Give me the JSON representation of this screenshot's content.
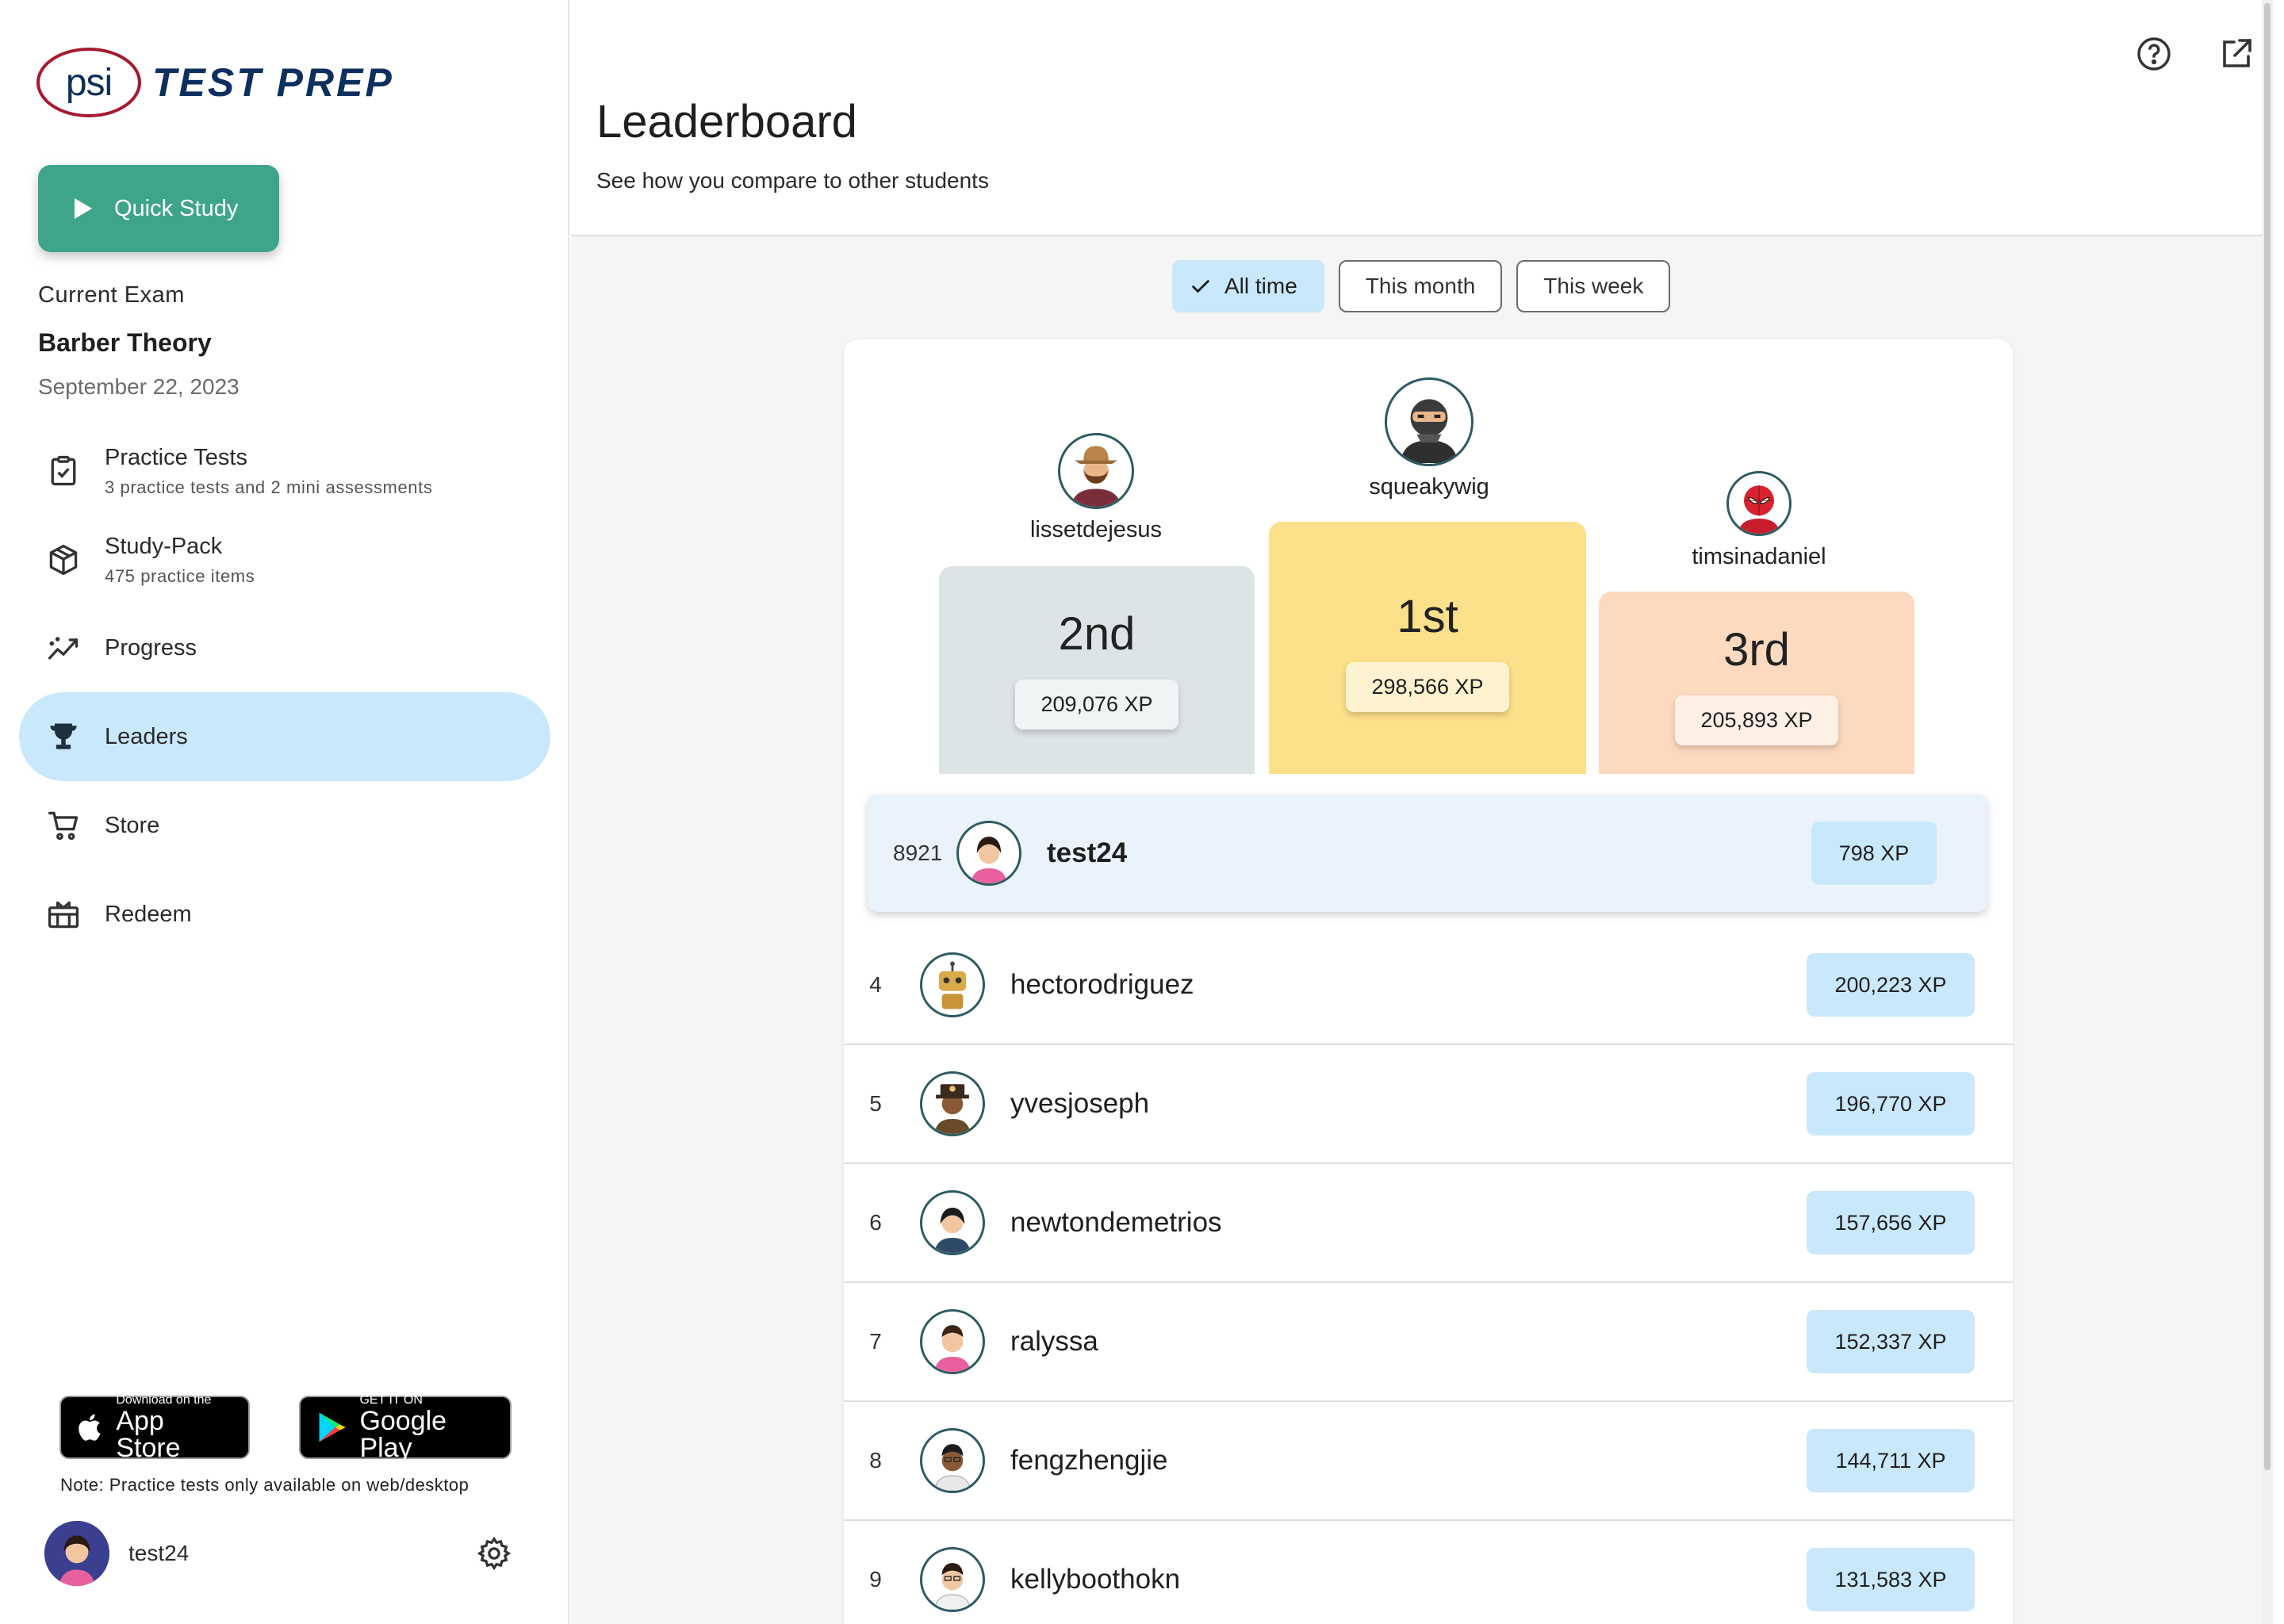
{
  "brand": {
    "mark": "psi",
    "name": "TEST PREP",
    "color": "#a6192e",
    "navy": "#0d2f5f"
  },
  "sidebar": {
    "quick_study_label": "Quick Study",
    "current_exam_label": "Current Exam",
    "exam_name": "Barber Theory",
    "exam_date": "September 22, 2023",
    "nav": [
      {
        "label": "Practice Tests",
        "sub": "3 practice tests and 2 mini assessments",
        "icon": "clipboard-check-icon"
      },
      {
        "label": "Study-Pack",
        "sub": "475 practice items",
        "icon": "cube-icon"
      },
      {
        "label": "Progress",
        "icon": "trend-icon"
      },
      {
        "label": "Leaders",
        "icon": "trophy-icon",
        "active": true
      },
      {
        "label": "Store",
        "icon": "cart-icon"
      },
      {
        "label": "Redeem",
        "icon": "gift-icon"
      }
    ],
    "app_store": {
      "small": "Download on the",
      "big": "App Store"
    },
    "google_play": {
      "small": "GET IT ON",
      "big": "Google Play"
    },
    "note": "Note: Practice tests only available on web/desktop",
    "username": "test24"
  },
  "header": {
    "title": "Leaderboard",
    "subtitle": "See how you compare to other students",
    "icons": [
      "help-icon",
      "open-external-icon"
    ]
  },
  "filters": {
    "options": [
      "All time",
      "This month",
      "This week"
    ],
    "selected": "All time"
  },
  "podium": {
    "first": {
      "name": "squeakywig",
      "place": "1st",
      "xp": "298,566 XP",
      "color": "#fde08a"
    },
    "second": {
      "name": "lissetdejesus",
      "place": "2nd",
      "xp": "209,076 XP",
      "color": "#dde4e6"
    },
    "third": {
      "name": "timsinadaniel",
      "place": "3rd",
      "xp": "205,893 XP",
      "color": "#fdd9bf"
    }
  },
  "current_user": {
    "rank": "8921",
    "name": "test24",
    "xp": "798 XP"
  },
  "rows": [
    {
      "rank": "4",
      "name": "hectorodriguez",
      "xp": "200,223 XP"
    },
    {
      "rank": "5",
      "name": "yvesjoseph",
      "xp": "196,770 XP"
    },
    {
      "rank": "6",
      "name": "newtondemetrios",
      "xp": "157,656 XP"
    },
    {
      "rank": "7",
      "name": "ralyssa",
      "xp": "152,337 XP"
    },
    {
      "rank": "8",
      "name": "fengzhengjie",
      "xp": "144,711 XP"
    },
    {
      "rank": "9",
      "name": "kellyboothokn",
      "xp": "131,583 XP"
    }
  ]
}
